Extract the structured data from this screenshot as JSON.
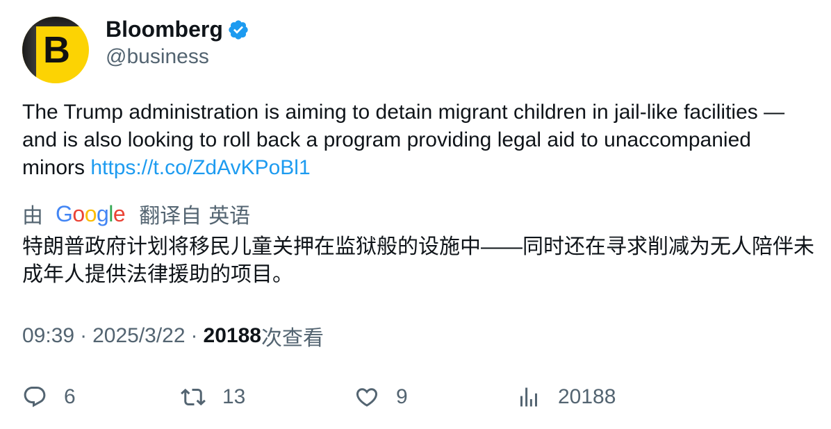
{
  "author": {
    "display_name": "Bloomberg",
    "handle": "@business",
    "avatar_letter": "B",
    "verified": true
  },
  "tweet": {
    "text": "The Trump administration is aiming to detain migrant children in jail-like facilities — and is also looking to roll back a program providing legal aid to unaccompanied minors",
    "link": "https://t.co/ZdAvKPoBl1"
  },
  "translation": {
    "by": "由",
    "provider": "Google",
    "label": "翻译自",
    "language": "英语",
    "text": "特朗普政府计划将移民儿童关押在监狱般的设施中——同时还在寻求削减为无人陪伴未成年人提供法律援助的项目。"
  },
  "meta": {
    "time": "09:39",
    "separator": "·",
    "date": "2025/3/22",
    "views": "20188",
    "views_label": "次查看"
  },
  "actions": {
    "replies": "6",
    "retweets": "13",
    "likes": "9",
    "views": "20188"
  },
  "colors": {
    "text": "#0f1419",
    "secondary": "#536471",
    "link": "#1d9bf0",
    "avatar_bg": "#fcd303"
  }
}
